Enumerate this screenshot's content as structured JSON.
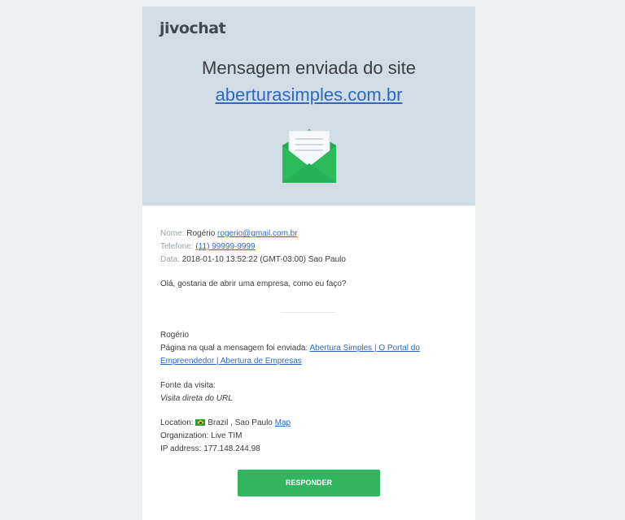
{
  "brand": {
    "logo": "jivochat"
  },
  "header": {
    "title_line1": "Mensagem enviada do site",
    "site_link": "aberturasimples.com.br"
  },
  "icons": {
    "envelope": "email-opened-icon",
    "flag": "brazil-flag-icon"
  },
  "colors": {
    "header_bg": "#d1dde5",
    "accent_green": "#31b560",
    "link_blue": "#2d69c2"
  },
  "message": {
    "name_label": "Nome:",
    "name_value": "Rogério",
    "email": "rogerio@gmail.com.br",
    "phone_label": "Telefone:",
    "phone": "(11) 99999-9999",
    "date_label": "Data:",
    "date": "2018-01-10 13:52:22 (GMT-03:00) Sao Paulo",
    "text": "Olá, gostaria de abrir uma empresa, como eu faço?"
  },
  "details": {
    "sender": "Rogério",
    "page_label": "Página na qual a mensagem foi enviada:",
    "page_link_1": "Abertura Simples | O Portal do",
    "page_link_2": "Empreendedor | Abertura de Empresas",
    "source_label": "Fonte da visita:",
    "source_value": "Visita direta do URL",
    "location_label": "Location:",
    "location_value": "Brazil , Sao Paulo",
    "map_link": "Map",
    "org_label": "Organization:",
    "org_value": "Live TIM",
    "ip_label": "IP address:",
    "ip_value": "177.148.244.98"
  },
  "actions": {
    "reply_label": "RESPONDER"
  }
}
